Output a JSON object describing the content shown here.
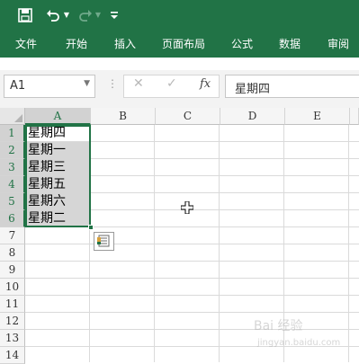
{
  "ribbon": {
    "tabs": [
      "文件",
      "开始",
      "插入",
      "页面布局",
      "公式",
      "数据",
      "审阅"
    ]
  },
  "formula_bar": {
    "name_box": "A1",
    "content": "星期四",
    "fx_label": "fx"
  },
  "sheet": {
    "columns": [
      "A",
      "B",
      "C",
      "D",
      "E"
    ],
    "rows": [
      "1",
      "2",
      "3",
      "4",
      "5",
      "6",
      "7",
      "8",
      "9",
      "10",
      "11",
      "12",
      "13",
      "14"
    ],
    "cells_a": [
      "星期四",
      "星期一",
      "星期三",
      "星期五",
      "星期六",
      "星期二"
    ]
  },
  "watermark": {
    "text": "Bai 经验",
    "sub": "jingyan.baidu.com"
  },
  "colors": {
    "accent": "#217346",
    "selection_fill": "#d6d6d6"
  },
  "icons": {
    "save": "save-icon",
    "undo": "undo-icon",
    "redo": "redo-icon",
    "customize": "customize-qat-icon",
    "cancel": "cancel-icon",
    "enter": "enter-icon",
    "autofill_options": "autofill-options-icon",
    "cursor": "cell-select-cursor-icon"
  }
}
